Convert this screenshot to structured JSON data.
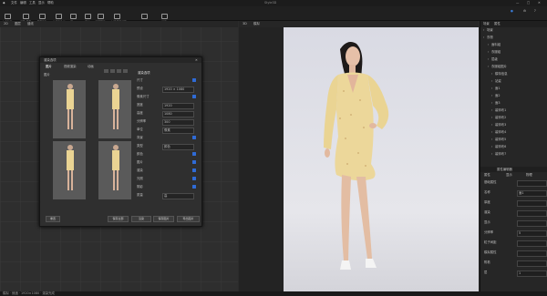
{
  "app": {
    "title": "Style3D",
    "menu": [
      "文件",
      "编辑",
      "工具",
      "显示",
      "帮助"
    ]
  },
  "toolbar": {
    "tools": [
      "文件新建",
      "打开/保存",
      "保存修改",
      "放置新物体",
      "导入",
      "导出",
      "模型预览",
      "材质库与模型",
      "Render",
      "显示"
    ]
  },
  "viewport2d": {
    "tabs": [
      "2D",
      "图层",
      "缝线"
    ]
  },
  "viewport3d": {
    "tabs": [
      "3D",
      "模拟"
    ]
  },
  "right_panel": {
    "header_tabs": [
      "场景",
      "属性"
    ],
    "tree": [
      "场景",
      "衣物",
      "面料组",
      "衣服组",
      "层级",
      "衣服组图片",
      "模特信息",
      "站姿",
      "面1",
      "面2",
      "面3",
      "装饰布1",
      "装饰布2",
      "装饰布3",
      "装饰布4",
      "装饰布5",
      "装饰布6",
      "装饰布7"
    ],
    "properties_title": "属性编辑器",
    "prop_tabs": [
      "属性",
      "显示",
      "物理"
    ],
    "props": [
      {
        "label": "基础属性",
        "value": ""
      },
      {
        "label": "名称",
        "value": "面1"
      },
      {
        "label": "厚度",
        "value": ""
      },
      {
        "label": "渲染",
        "value": ""
      },
      {
        "label": "显示",
        "value": ""
      },
      {
        "label": "分辨率",
        "value": "5"
      },
      {
        "label": "粒子间距",
        "value": ""
      },
      {
        "label": "模拟属性",
        "value": ""
      },
      {
        "label": "附着",
        "value": ""
      },
      {
        "label": "层",
        "value": "1"
      }
    ]
  },
  "dialog": {
    "title": "渲染选项",
    "tabs": [
      "图片",
      "视频渲染",
      "动画"
    ],
    "left_label": "图片",
    "section_title": "渲染选项",
    "settings": [
      {
        "label": "尺寸",
        "value": ""
      },
      {
        "label": "预设",
        "value": "1920 × 1080"
      },
      {
        "label": "像素尺寸",
        "value": ""
      },
      {
        "label": "宽度",
        "value": "1920"
      },
      {
        "label": "高度",
        "value": "1080"
      },
      {
        "label": "分辨率",
        "value": "300"
      },
      {
        "label": "单位",
        "value": "像素"
      },
      {
        "label": "背景",
        "value": ""
      },
      {
        "label": "类型",
        "value": "颜色"
      },
      {
        "label": "颜色",
        "value": ""
      },
      {
        "label": "图片",
        "value": ""
      },
      {
        "label": "渲染",
        "value": ""
      },
      {
        "label": "光照",
        "value": ""
      },
      {
        "label": "阴影",
        "value": ""
      },
      {
        "label": "质量",
        "value": "高"
      }
    ],
    "buttons": {
      "reset": "重置",
      "save_all": "保存全部",
      "render": "渲染",
      "save": "保存图片",
      "export": "导出图片"
    }
  },
  "status": {
    "text": "模拟 · 就绪 · 1920×1080 · 渲染完成"
  }
}
